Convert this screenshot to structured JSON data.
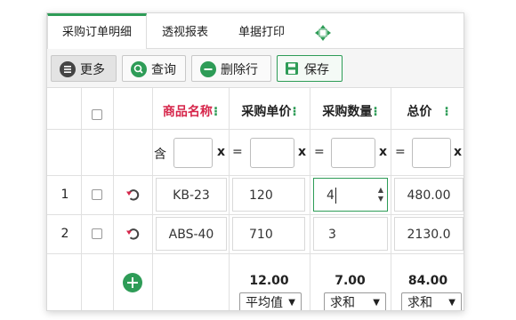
{
  "tabs": {
    "order_detail": "采购订单明细",
    "pivot_report": "透视报表",
    "print": "单据打印"
  },
  "toolbar": {
    "more": "更多",
    "query": "查询",
    "delete_row": "删除行",
    "save": "保存"
  },
  "columns": {
    "product_name": "商品名称",
    "unit_price": "采购单价",
    "quantity": "采购数量",
    "total": "总价",
    "menu_glyph": "⁝"
  },
  "filters": {
    "contains": "含",
    "equals": "=",
    "clear": "x"
  },
  "rows": [
    {
      "num": "1",
      "product": "KB-23",
      "price": "120",
      "qty": "4",
      "total": "480.00"
    },
    {
      "num": "2",
      "product": "ABS-40",
      "price": "710",
      "qty": "3",
      "total": "2130.0"
    }
  ],
  "summary": {
    "price_value": "12.00",
    "price_func": "平均值",
    "qty_value": "7.00",
    "qty_func": "求和",
    "total_value": "84.00",
    "total_func": "求和"
  },
  "colors": {
    "accent": "#2e9c57",
    "required": "#d6254a",
    "undo": "#d6254a"
  }
}
